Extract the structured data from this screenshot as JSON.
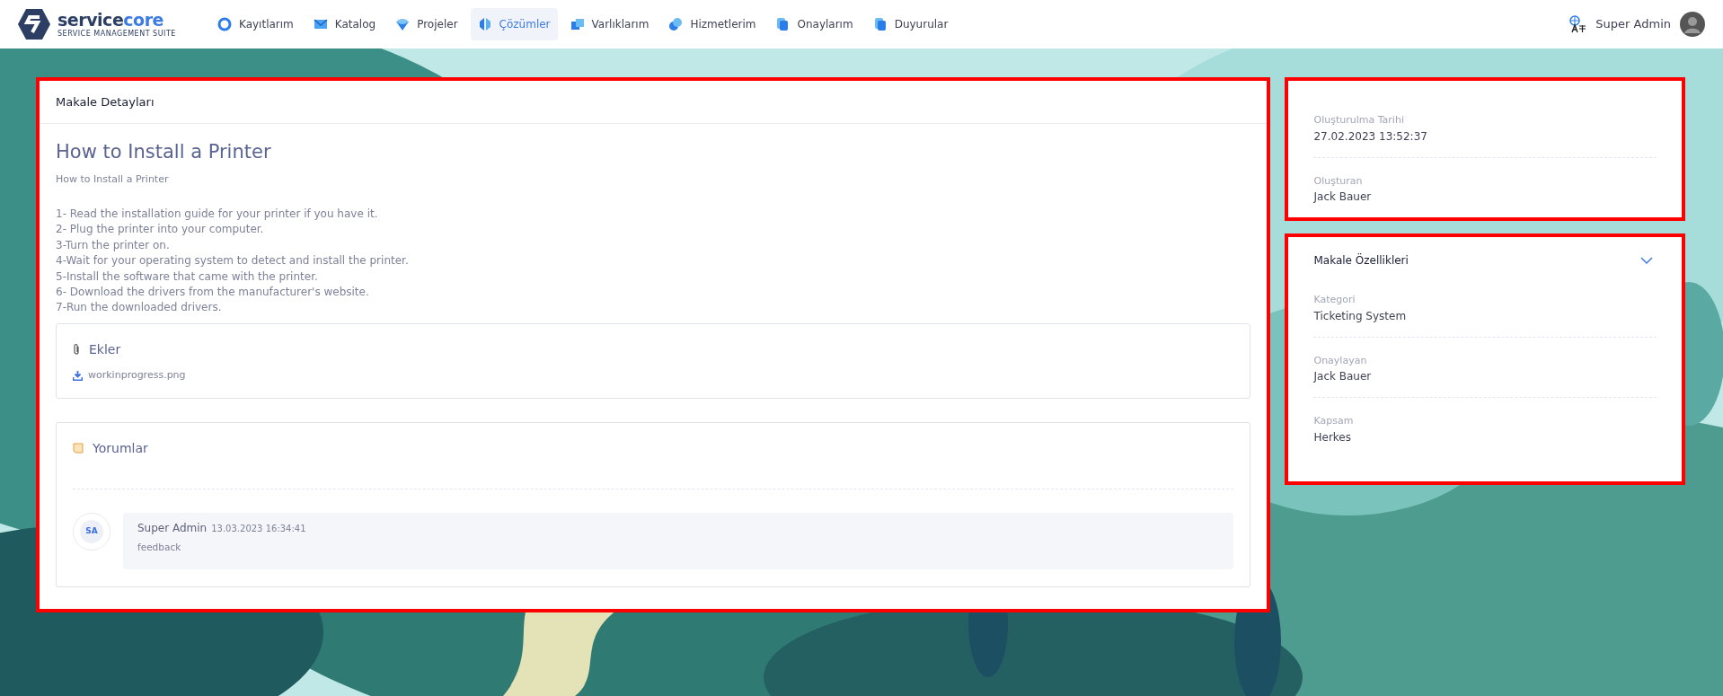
{
  "brand": {
    "name_prefix": "service",
    "name_suffix": "core",
    "tagline": "SERVICE MANAGEMENT SUITE"
  },
  "nav": [
    {
      "label": "Kayıtlarım",
      "kind": "ring",
      "selected": false
    },
    {
      "label": "Katalog",
      "kind": "envelope",
      "selected": false
    },
    {
      "label": "Projeler",
      "kind": "diamond",
      "selected": false
    },
    {
      "label": "Çözümler",
      "kind": "split",
      "selected": true
    },
    {
      "label": "Varlıklarım",
      "kind": "cubes",
      "selected": false
    },
    {
      "label": "Hizmetlerim",
      "kind": "drops",
      "selected": false
    },
    {
      "label": "Onaylarım",
      "kind": "docs",
      "selected": false
    },
    {
      "label": "Duyurular",
      "kind": "docs",
      "selected": false
    }
  ],
  "user": {
    "name": "Super Admin"
  },
  "article": {
    "header": "Makale Detayları",
    "title": "How to Install a Printer",
    "subtitle": "How to Install a Printer",
    "steps": [
      "1- Read the installation guide for your printer if you have it.",
      "2- Plug the printer into your computer.",
      "3-Turn the printer on.",
      "4-Wait for your operating system to detect and install the printer.",
      "5-Install the software that came with the printer.",
      "6- Download the drivers from the manufacturer's website.",
      "7-Run the downloaded drivers."
    ],
    "attachments": {
      "title": "Ekler",
      "files": [
        "workinprogress.png"
      ]
    },
    "comments": {
      "title": "Yorumlar",
      "items": [
        {
          "initials": "SA",
          "author": "Super Admin",
          "date": "13.03.2023 16:34:41",
          "text": "feedback"
        }
      ]
    }
  },
  "meta": [
    {
      "label": "Oluşturulma Tarihi",
      "value": "27.02.2023 13:52:37"
    },
    {
      "label": "Oluşturan",
      "value": "Jack Bauer"
    }
  ],
  "properties": {
    "title": "Makale Özellikleri",
    "expanded": true,
    "items": [
      {
        "label": "Kategori",
        "value": "Ticketing System"
      },
      {
        "label": "Onaylayan",
        "value": "Jack Bauer"
      },
      {
        "label": "Kapsam",
        "value": "Herkes"
      }
    ]
  }
}
